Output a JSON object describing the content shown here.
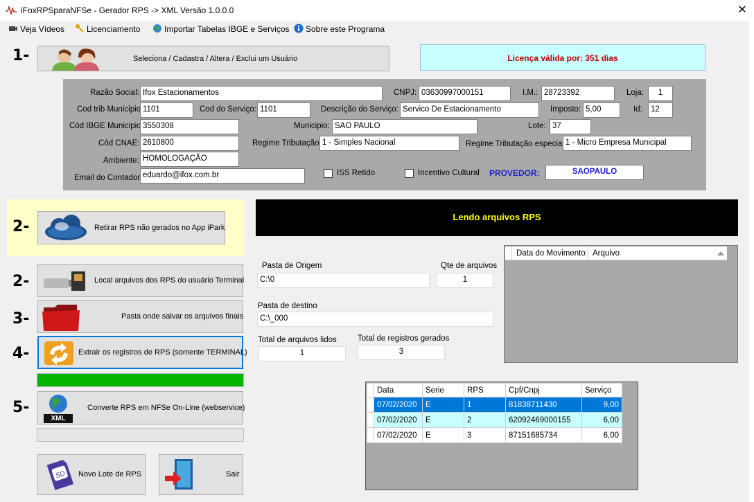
{
  "window": {
    "title": "iFoxRPSparaNFSe - Gerador RPS -> XML Versão 1.0.0.0",
    "close": "✕"
  },
  "menu": [
    {
      "label": "Veja Vídeos"
    },
    {
      "label": "Licenciamento"
    },
    {
      "label": "Importar Tabelas IBGE e Serviços"
    },
    {
      "label": "Sobre este Programa"
    }
  ],
  "steps": {
    "s1": "1-",
    "s2a": "2-",
    "s2b": "2-",
    "s3": "3-",
    "s4": "4-",
    "s5": "5-"
  },
  "buttons": {
    "user": "Seleciona / Cadastra / Altera / Exclui um Usuário",
    "retirar": "Retirar RPS não gerados no App iPark",
    "local": "Local arquivos dos RPS do usuário Terminal",
    "pasta": "Pasta onde salvar os arquivos finais",
    "extrair": "Extrair os registros de RPS (somente TERMINAL)",
    "converte": "Converte RPS em NFSe On-Line (webservice)",
    "novo_lote": "Novo Lote de RPS",
    "sair": "Sair",
    "xml_badge": "XML"
  },
  "license": "Licença válida por: 351 dias",
  "form": {
    "razao_label": "Razão Social:",
    "razao": "Ifox Estacionamentos",
    "cnpj_label": "CNPJ:",
    "cnpj": "03630997000151",
    "im_label": "I.M.:",
    "im": "28723392",
    "loja_label": "Loja:",
    "loja": "1",
    "codtrib_label": "Cod trib Municipio:",
    "codtrib": "1101",
    "codserv_label": "Cod do Serviço:",
    "codserv": "1101",
    "desc_label": "Descrição do Serviço:",
    "desc": "Servico De Estacionamento",
    "imposto_label": "Imposto:",
    "imposto": "5,00",
    "id_label": "Id:",
    "id": "12",
    "ibge_label": "Cód IBGE Municipio:",
    "ibge": "3550308",
    "municipio_label": "Municipio:",
    "municipio": "SAO PAULO",
    "lote_label": "Lote:",
    "lote": "37",
    "cnae_label": "Cód CNAE:",
    "cnae": "2610800",
    "regime_label": "Regime Tributação:",
    "regime": "1 - Simples Nacional",
    "regesp_label": "Regime Tributação especial:",
    "regesp": "1 - Micro Empresa Municipal",
    "ambiente_label": "Ambiente:",
    "ambiente": "HOMOLOGAÇÃO",
    "iss_label": "ISS Retido",
    "incentivo_label": "Incentivo Cultural",
    "email_label": "Email do Contador:",
    "email": "eduardo@ifox.com.br",
    "provedor_label": "PROVEDOR:",
    "provedor": "SAOPAULO"
  },
  "status_banner": "Lendo arquivos RPS",
  "paths": {
    "origem_label": "Pasta de Origem",
    "origem": "C:\\0",
    "qte_label": "Qte de arquivos",
    "qte": "1",
    "destino_label": "Pasta de destino",
    "destino": "C:\\_000",
    "lidos_label": "Total de arquivos lidos",
    "lidos": "1",
    "gerados_label": "Total de registros gerados",
    "gerados": "3"
  },
  "files_grid": {
    "columns": [
      "Data do Movimento",
      "Arquivo"
    ]
  },
  "rps_grid": {
    "columns": [
      "Data",
      "Serie",
      "RPS",
      "Cpf/Cnpj",
      "Serviço"
    ],
    "rows": [
      [
        "07/02/2020",
        "E",
        "1",
        "81838711430",
        "9,00"
      ],
      [
        "07/02/2020",
        "E",
        "2",
        "62092469000155",
        "6,00"
      ],
      [
        "07/02/2020",
        "E",
        "3",
        "87151685734",
        "6,00"
      ]
    ]
  },
  "colors": {
    "banner_bg": "#000000",
    "banner_text": "#ffff00",
    "license_bg": "#c8ffff",
    "license_text": "#c00000",
    "progress": "#00b400",
    "selected_row": "#0078d7",
    "alt_row": "#c8ffff",
    "provedor": "#2020d0"
  }
}
